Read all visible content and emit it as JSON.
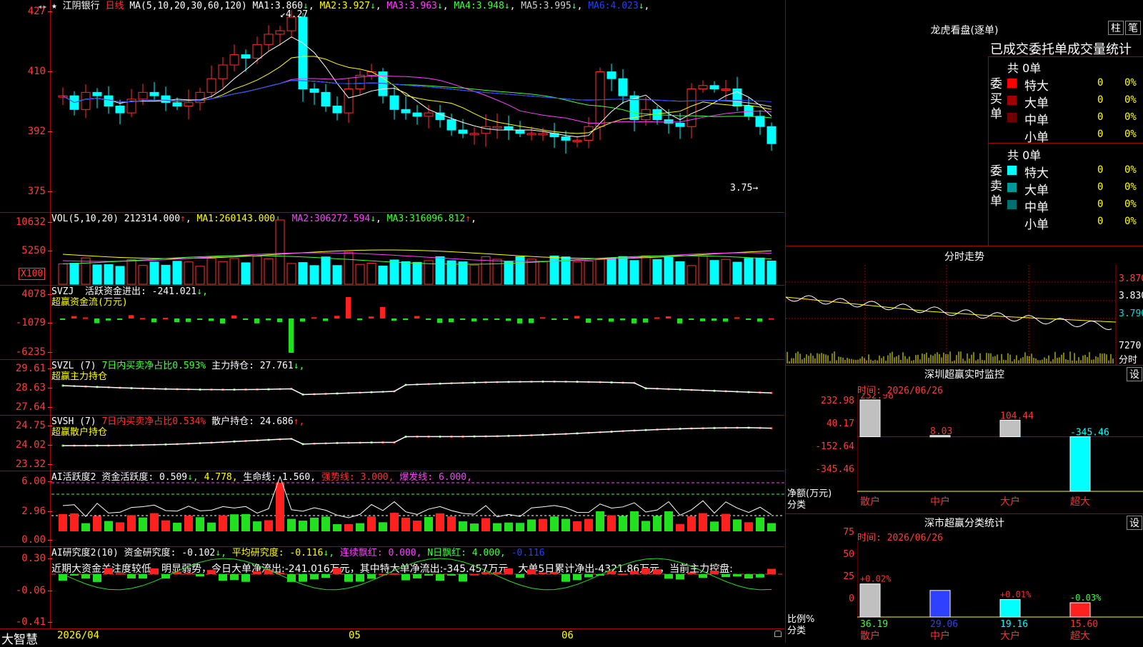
{
  "stock": {
    "name": "江阴银行",
    "period": "日线",
    "ma_params": "MA(5,10,20,30,60,120)"
  },
  "top_toolbar": {
    "star": "★",
    "high_label": "4.27",
    "low_label": "3.75"
  },
  "kline": {
    "ticks": [
      "427",
      "410",
      "392",
      "375"
    ],
    "ma": [
      {
        "label": "MA1:",
        "value": "3.860",
        "arrow": "↓",
        "color": "#ffffff"
      },
      {
        "label": "MA2:",
        "value": "3.927",
        "arrow": "↓",
        "color": "#ffff00"
      },
      {
        "label": "MA3:",
        "value": "3.963",
        "arrow": "↓",
        "color": "#ff40ff"
      },
      {
        "label": "MA4:",
        "value": "3.948",
        "arrow": "↓",
        "color": "#40ff40"
      },
      {
        "label": "MA5:",
        "value": "3.995",
        "arrow": "↓",
        "color": "#d0d0d0"
      },
      {
        "label": "MA6:",
        "value": "4.023",
        "arrow": "↓",
        "color": "#2040ff"
      }
    ]
  },
  "vol": {
    "ticks": [
      "10632",
      "5250",
      "X100"
    ],
    "params": "VOL(5,10,20)",
    "value": "212314.000",
    "arrow": "↑",
    "ma": [
      {
        "label": "MA1:",
        "value": "260143.000",
        "arrow": "↓",
        "color": "#ffff00"
      },
      {
        "label": "MA2:",
        "value": "306272.594",
        "arrow": "↓",
        "color": "#ff40ff"
      },
      {
        "label": "MA3:",
        "value": "316096.812",
        "arrow": "↑",
        "color": "#40ff40"
      }
    ]
  },
  "svzj": {
    "ticks": [
      "4078",
      "-1079",
      "-6235"
    ],
    "name": "SVZJ",
    "label": "活跃资金进出:",
    "value": "-241.021",
    "arrow": "↓,",
    "sub": "超赢资金流(万元)"
  },
  "svzl": {
    "ticks": [
      "29.61",
      "28.63",
      "27.64"
    ],
    "name": "SVZL (7)",
    "ratio_text": "7日内买卖净占比0.593%",
    "label": "主力持仓:",
    "value": "27.761",
    "arrow": "↓,",
    "sub": "超赢主力持仓"
  },
  "svsh": {
    "ticks": [
      "24.75",
      "24.02",
      "23.32"
    ],
    "name": "SVSH (7)",
    "ratio_text": "7日内买卖净占比0.534%",
    "label": "散户持仓:",
    "value": "24.686",
    "arrow": "↑,",
    "sub": "超赢散户持仓"
  },
  "ai_active": {
    "ticks": [
      "6.00",
      "2.96",
      "0.00"
    ],
    "name": "AI活跃度2",
    "label": "资金活跃度:",
    "value": "0.509",
    "arrow": "↓,",
    "value2": "4.778,",
    "life_label": "生命线:",
    "life_value": "1.560,",
    "strong_label": "强势线:",
    "strong_value": "3.000,",
    "burst_label": "爆发线:",
    "burst_value": "6.000,"
  },
  "ai_research": {
    "ticks": [
      "0.30",
      "-0.06",
      "-0.41"
    ],
    "name": "AI研究度2(10)",
    "label": "资金研究度:",
    "value": "-0.102",
    "arrow": "↓,",
    "avg_label": "平均研究度:",
    "avg_value": "-0.116",
    "avg_arrow": "↓,",
    "red_label": "连续飘红:",
    "red_value": "0.000,",
    "n_label": "N日飘红:",
    "n_value": "4.000,",
    "last_value": "-0.116",
    "comment": "近期大资金关注度较低，明显弱势，今日大单净流出:-241.016万元，其中特大单净流出:-345.457万元，大单5日累计净出-4321.86万元，当前主力控盘:"
  },
  "bottom": {
    "brand": "大智慧",
    "date": "2026/04",
    "m05": "05",
    "m06": "06"
  },
  "lhb": {
    "title": "龙虎看盘(逐单)",
    "btn_col": "柱",
    "btn_pen": "笔",
    "subtitle": "已成交委托单成交量统计",
    "buy": {
      "side": "委买单",
      "total": "共 0单",
      "rows": [
        {
          "label": "特大",
          "value": "0",
          "pct": "0%",
          "color": "#ff0000"
        },
        {
          "label": "大单",
          "value": "0",
          "pct": "0%",
          "color": "#a00000"
        },
        {
          "label": "中单",
          "value": "0",
          "pct": "0%",
          "color": "#700000"
        },
        {
          "label": "小单",
          "value": "0",
          "pct": "0%",
          "color": "#000000"
        }
      ]
    },
    "sell": {
      "side": "委卖单",
      "total": "共 0单",
      "rows": [
        {
          "label": "特大",
          "value": "0",
          "pct": "0%",
          "color": "#00ffff"
        },
        {
          "label": "大单",
          "value": "0",
          "pct": "0%",
          "color": "#009999"
        },
        {
          "label": "中单",
          "value": "0",
          "pct": "0%",
          "color": "#006f6f"
        },
        {
          "label": "小单",
          "value": "0",
          "pct": "0%",
          "color": "#000000"
        }
      ]
    }
  },
  "intraday": {
    "title": "分时走势",
    "ticks": [
      "3.870",
      "3.830",
      "3.790"
    ],
    "vol_tick": "7270",
    "unit": "分时"
  },
  "sz_monitor": {
    "title": "深圳超赢实时监控",
    "btn": "设",
    "time": "时间: 2026/06/26",
    "ticks": [
      "232.98",
      "40.17",
      "-152.64",
      "-345.46"
    ],
    "ylabel": "净额(万元)",
    "xlabel": "分类",
    "chart_data": {
      "type": "bar",
      "categories": [
        "散户",
        "中户",
        "大户",
        "超大"
      ],
      "values": [
        232.98,
        8.03,
        104.44,
        -345.46
      ],
      "labels": [
        "232.98",
        "8.03",
        "104.44",
        "-345.46"
      ],
      "ylim": [
        -345.46,
        232.98
      ]
    }
  },
  "sz_class": {
    "title": "深市超赢分类统计",
    "btn": "设",
    "time": "时间: 2026/06/26",
    "ticks": [
      "75",
      "50",
      "25",
      "0"
    ],
    "ylabel": "比例%",
    "xlabel": "分类",
    "chart_data": {
      "type": "bar",
      "categories": [
        "散户",
        "中户",
        "大户",
        "超大"
      ],
      "values": [
        36.19,
        29.06,
        19.16,
        15.6
      ],
      "changes": [
        "+0.02%",
        "",
        "+0.01%",
        "-0.03%"
      ],
      "ylim": [
        0,
        75
      ]
    }
  }
}
